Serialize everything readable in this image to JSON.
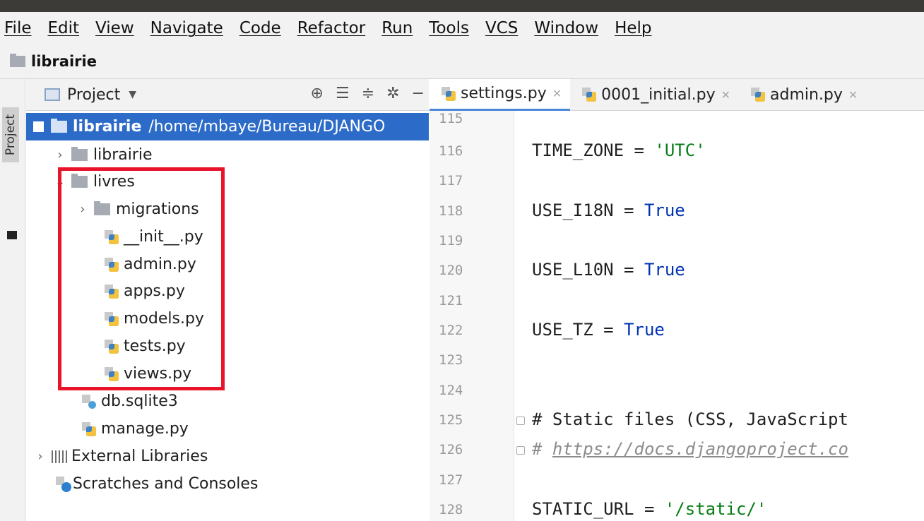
{
  "menu": [
    "File",
    "Edit",
    "View",
    "Navigate",
    "Code",
    "Refactor",
    "Run",
    "Tools",
    "VCS",
    "Window",
    "Help"
  ],
  "nav": {
    "project_name": "librairie"
  },
  "sidebar": {
    "strip_label": "Project"
  },
  "project_panel": {
    "title": "Project",
    "tree": {
      "root": {
        "name": "librairie",
        "path": "/home/mbaye/Bureau/DJANGO"
      },
      "librairie_pkg": "librairie",
      "livres": "livres",
      "migrations": "migrations",
      "files": [
        "__init__.py",
        "admin.py",
        "apps.py",
        "models.py",
        "tests.py",
        "views.py"
      ],
      "db": "db.sqlite3",
      "manage": "manage.py",
      "external": "External Libraries",
      "scratches": "Scratches and Consoles"
    }
  },
  "tabs": [
    {
      "label": "settings.py",
      "active": true
    },
    {
      "label": "0001_initial.py",
      "active": false
    },
    {
      "label": "admin.py",
      "active": false
    }
  ],
  "editor": {
    "line_numbers": [
      "115",
      "116",
      "117",
      "118",
      "119",
      "120",
      "121",
      "122",
      "123",
      "124",
      "125",
      "126",
      "127",
      "128"
    ],
    "lines": {
      "l116_name": "TIME_ZONE",
      "l116_op": " = ",
      "l116_val": "'UTC'",
      "l118_name": "USE_I18N",
      "l118_op": " = ",
      "l118_val": "True",
      "l120_name": "USE_L10N",
      "l120_op": " = ",
      "l120_val": "True",
      "l122_name": "USE_TZ",
      "l122_op": " = ",
      "l122_val": "True",
      "l125": "# Static files (CSS, JavaScript",
      "l126_hash": "# ",
      "l126_link": "https://docs.djangoproject.co",
      "l128_name": "STATIC_URL",
      "l128_op": " = ",
      "l128_val": "'/static/'"
    }
  },
  "colors": {
    "selection": "#2d6bc9",
    "highlight_box": "#e8142a",
    "string": "#067d17",
    "keyword": "#0033b3"
  }
}
